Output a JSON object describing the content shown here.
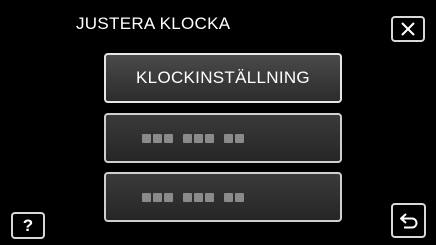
{
  "header": {
    "title": "JUSTERA KLOCKA",
    "close_icon": "close-icon"
  },
  "menu": {
    "items": [
      {
        "label": "KLOCKINSTÄLLNING",
        "enabled": true
      },
      {
        "label": "",
        "enabled": false
      },
      {
        "label": "",
        "enabled": false
      }
    ]
  },
  "footer": {
    "help_label": "?",
    "back_icon": "back-arrow-icon"
  }
}
